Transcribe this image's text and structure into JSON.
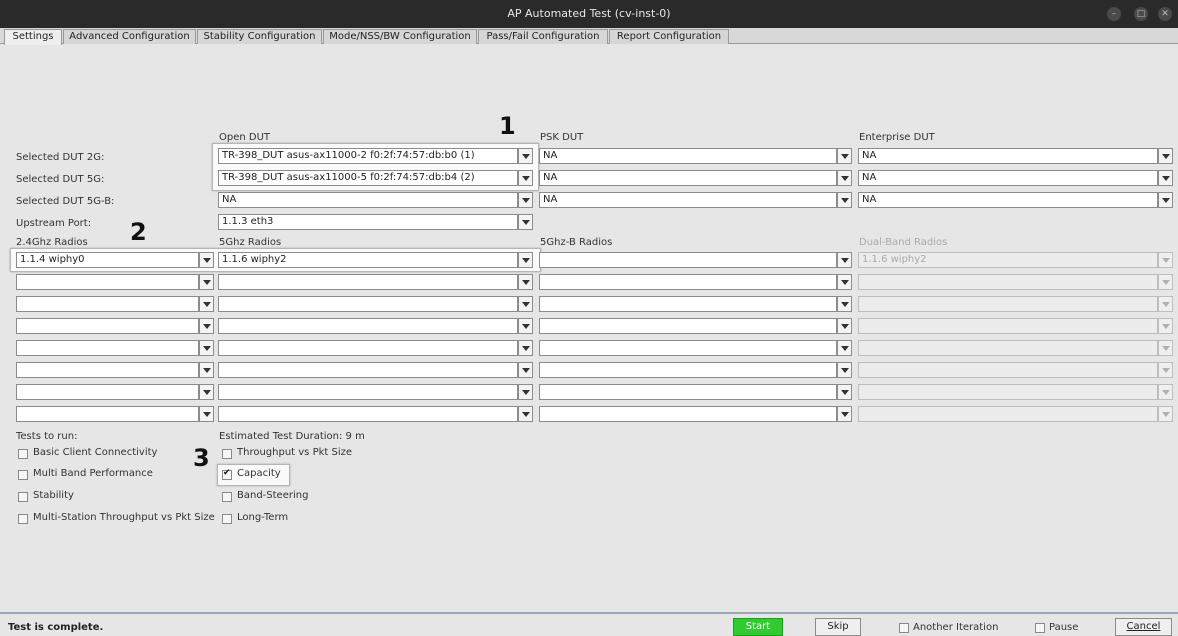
{
  "window": {
    "title": "AP Automated Test  (cv-inst-0)"
  },
  "tabs": [
    "Settings",
    "Advanced Configuration",
    "Stability Configuration",
    "Mode/NSS/BW Configuration",
    "Pass/Fail Configuration",
    "Report Configuration"
  ],
  "dut": {
    "col_headers": {
      "open": "Open DUT",
      "psk": "PSK DUT",
      "enterprise": "Enterprise DUT"
    },
    "rows": [
      {
        "label": "Selected DUT 2G:",
        "open": "TR-398_DUT asus-ax11000-2 f0:2f:74:57:db:b0 (1)",
        "psk": "NA",
        "enterprise": "NA"
      },
      {
        "label": "Selected DUT 5G:",
        "open": "TR-398_DUT asus-ax11000-5 f0:2f:74:57:db:b4 (2)",
        "psk": "NA",
        "enterprise": "NA"
      },
      {
        "label": "Selected DUT 5G-B:",
        "open": "NA",
        "psk": "NA",
        "enterprise": "NA"
      }
    ],
    "upstream": {
      "label": "Upstream Port:",
      "value": "1.1.3 eth3"
    }
  },
  "radios": {
    "headers": {
      "r24": "2.4Ghz Radios",
      "r5": "5Ghz Radios",
      "r5b": "5Ghz-B Radios",
      "dual": "Dual-Band Radios"
    },
    "first_row": {
      "r24": "1.1.4 wiphy0",
      "r5": "1.1.6 wiphy2",
      "r5b": "",
      "dual": "1.1.6 wiphy2"
    }
  },
  "tests": {
    "label": "Tests to run:",
    "duration": "Estimated Test Duration: 9 m",
    "left": [
      "Basic Client Connectivity",
      "Multi Band Performance",
      "Stability",
      "Multi-Station Throughput vs Pkt Size"
    ],
    "right": [
      "Throughput vs Pkt Size",
      "Capacity",
      "Band-Steering",
      "Long-Term"
    ]
  },
  "callouts": [
    "1",
    "2",
    "3"
  ],
  "status": {
    "text": "Test is complete.",
    "start": "Start",
    "skip": "Skip",
    "another": "Another Iteration",
    "pause": "Pause",
    "cancel": "Cancel"
  },
  "colors": {
    "start_button": "#2ecc2e",
    "titlebar": "#2a2a2a"
  }
}
